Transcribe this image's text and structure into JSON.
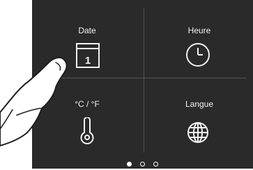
{
  "tiles": {
    "date": {
      "label": "Date",
      "icon": "calendar-icon",
      "calendar_day": "1"
    },
    "time": {
      "label": "Heure",
      "icon": "clock-icon"
    },
    "units": {
      "label": "°C / °F",
      "icon": "thermometer-icon"
    },
    "language": {
      "label": "Langue",
      "icon": "globe-icon"
    }
  },
  "pagination": {
    "pages": 3,
    "current": 1
  },
  "colors": {
    "screen_bg": "#2a2a2a",
    "foreground": "#f2f2f2",
    "divider": "#555555"
  },
  "overlay": {
    "icon": "pointing-finger-icon"
  }
}
